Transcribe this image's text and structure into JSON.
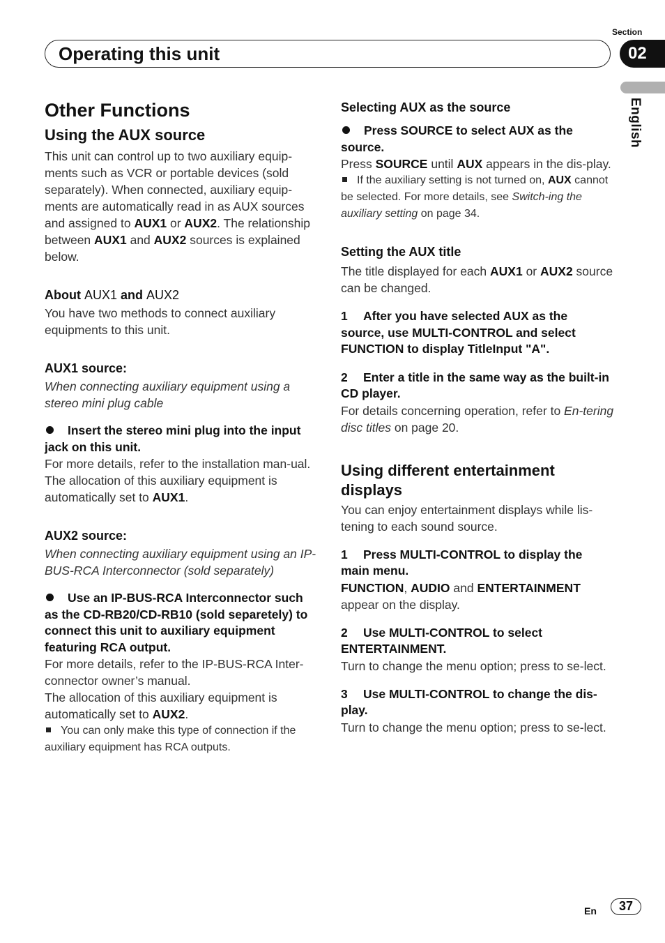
{
  "header": {
    "section_label": "Section",
    "section_number": "02",
    "title": "Operating this unit",
    "language_tab": "English"
  },
  "left": {
    "title": "Other Functions",
    "aux_heading": "Using the AUX source",
    "aux_intro": {
      "t1": "This unit can control up to two auxiliary equip-ments such as VCR or portable devices (sold separately). When connected, auxiliary equip-ments are automatically read in as AUX sources and assigned to ",
      "b1": "AUX1",
      "t2": " or ",
      "b2": "AUX2",
      "t3": ". The relationship between ",
      "b3": "AUX1",
      "t4": " and ",
      "b4": "AUX2",
      "t5": " sources is explained below."
    },
    "about_heading_b1": "About ",
    "about_heading_n1": "AUX1",
    "about_heading_b2": " and ",
    "about_heading_n2": "AUX2",
    "about_text": "You have two methods to connect auxiliary equipments to this unit.",
    "aux1": {
      "heading_n": "AUX1",
      "heading_b": " source:",
      "italic": "When connecting auxiliary equipment using a stereo mini plug cable",
      "bullet": "Insert the stereo mini plug into the input jack on this unit.",
      "text1": "For more details, refer to the installation man-ual.",
      "text2": "The allocation of this auxiliary equipment is automatically set to ",
      "text2_bold": "AUX1",
      "text2_end": "."
    },
    "aux2": {
      "heading_n": "AUX2",
      "heading_b": " source:",
      "italic": "When connecting auxiliary equipment using an IP-BUS-RCA Interconnector (sold separately)",
      "bullet": "Use an IP-BUS-RCA Interconnector such as the CD-RB20/CD-RB10 (sold separetely) to connect this unit to auxiliary equipment featuring RCA output.",
      "text1": "For more details, refer to the IP-BUS-RCA Inter-connector owner’s manual.",
      "text2": "The allocation of this auxiliary equipment is automatically set to ",
      "text2_bold": "AUX2",
      "text2_end": ".",
      "note": "You can only make this type of connection if the auxiliary equipment has RCA outputs."
    }
  },
  "right": {
    "select_heading": "Selecting AUX as the source",
    "select_bullet": "Press SOURCE to select AUX as the source.",
    "select_text": {
      "t1": "Press ",
      "b1": "SOURCE",
      "t2": " until ",
      "b2": "AUX",
      "t3": " appears in the dis-play."
    },
    "select_note": {
      "t1": "If the auxiliary setting is not turned on, ",
      "b1": "AUX",
      "t2": " cannot be selected. For more details, see ",
      "i1": "Switch-ing the auxiliary setting",
      "t3": " on page 34."
    },
    "title_heading": "Setting the AUX title",
    "title_text": {
      "t1": "The title displayed for each ",
      "b1": "AUX1",
      "t2": " or ",
      "b2": "AUX2",
      "t3": " source can be changed."
    },
    "title_steps": [
      {
        "num": "1",
        "text": "After you have selected AUX as the source, use MULTI-CONTROL and select FUNCTION to display TitleInput \"A\"."
      },
      {
        "num": "2",
        "text": "Enter a title in the same way as the built-in CD player."
      }
    ],
    "title_step2_text": {
      "t1": "For details concerning operation, refer to ",
      "i1": "En-tering disc titles",
      "t2": " on page 20."
    },
    "ent_heading": "Using different entertainment displays",
    "ent_intro": "You can enjoy entertainment displays while lis-tening to each sound source.",
    "ent_steps": [
      {
        "num": "1",
        "text": "Press MULTI-CONTROL to display the main menu."
      },
      {
        "num": "2",
        "text": "Use MULTI-CONTROL to select ENTERTAINMENT."
      },
      {
        "num": "3",
        "text": "Use MULTI-CONTROL to change the dis-play."
      }
    ],
    "ent_step1_text": {
      "b1": "FUNCTION",
      "t1": ", ",
      "b2": "AUDIO",
      "t2": " and ",
      "b3": "ENTERTAINMENT",
      "t3": " appear on the display."
    },
    "ent_step2_text": "Turn to change the menu option; press to se-lect.",
    "ent_step3_text": "Turn to change the menu option; press to se-lect."
  },
  "footer": {
    "lang_code": "En",
    "page_number": "37"
  }
}
